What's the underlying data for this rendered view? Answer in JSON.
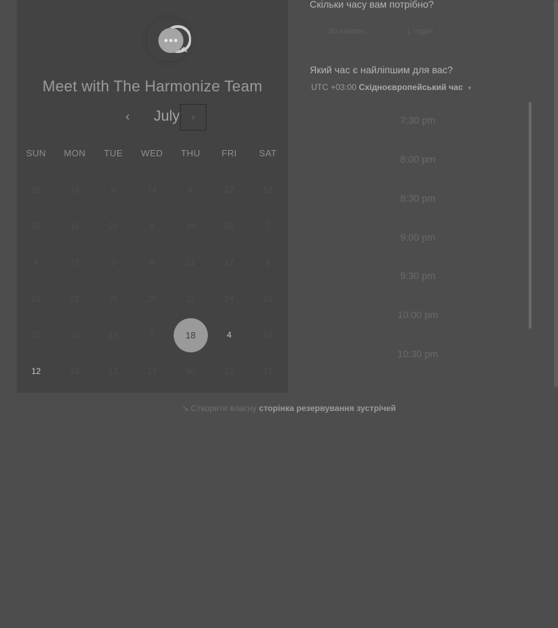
{
  "calendar": {
    "host_title": "Meet with The Harmonize Team",
    "month": "July",
    "prev_icon": "chevron-left-icon",
    "next_icon": "chevron-right-icon",
    "weekdays": [
      "SUN",
      "MON",
      "TUE",
      "WED",
      "THU",
      "FRI",
      "SAT"
    ],
    "weeks": [
      [
        "28",
        "16",
        "5",
        "14",
        "9",
        "22",
        "12"
      ],
      [
        "16",
        "11",
        "21",
        "8",
        "19",
        "26",
        "7"
      ],
      [
        "4",
        "27",
        "3",
        "4",
        "11",
        "17",
        "8"
      ],
      [
        "29",
        "21",
        "25",
        "20",
        "11",
        "24",
        "21"
      ],
      [
        "27",
        "10",
        "19",
        "5",
        "18",
        "4",
        "14"
      ],
      [
        "12",
        "15",
        "13",
        "13",
        "30",
        "22",
        "21"
      ]
    ],
    "selected_day": "18",
    "available_days": [
      "4",
      "12"
    ]
  },
  "duration": {
    "title": "Скільки часу вам потрібно?",
    "options": [
      "30 хвилин",
      "1 годин"
    ]
  },
  "time": {
    "title": "Який час є найліпшим для вас?",
    "timezone_offset": "UTC +03:00",
    "timezone_name": "Східноєвропейський час",
    "slots": [
      "7:30 pm",
      "8:00 pm",
      "8:30 pm",
      "9:00 pm",
      "9:30 pm",
      "10:00 pm",
      "10:30 pm"
    ]
  },
  "footer": {
    "prefix": "Створити власну",
    "link": "сторінка резервування зустрічей"
  },
  "colors": {
    "background": "#4d4d4d",
    "card": "#434343",
    "selected_day": "#9a9a9a"
  }
}
